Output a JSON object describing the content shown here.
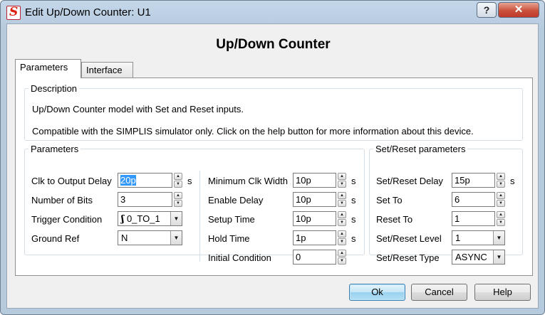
{
  "window": {
    "title": "Edit Up/Down Counter: U1",
    "help_glyph": "?",
    "close_glyph": "✕"
  },
  "dialog": {
    "heading": "Up/Down Counter"
  },
  "tabs": [
    {
      "label": "Parameters"
    },
    {
      "label": "Interface"
    }
  ],
  "description": {
    "legend": "Description",
    "line1": "Up/Down Counter model with Set and Reset inputs.",
    "line2": "Compatible with the SIMPLIS simulator only. Click on the help button for more information about this device."
  },
  "parameters": {
    "legend": "Parameters",
    "clk_to_output_delay": {
      "label": "Clk to Output Delay",
      "value": "20p",
      "unit": "s"
    },
    "number_of_bits": {
      "label": "Number of Bits",
      "value": "3"
    },
    "trigger_condition": {
      "label": "Trigger Condition",
      "value": "0_TO_1",
      "glyph": "ʃ"
    },
    "ground_ref": {
      "label": "Ground Ref",
      "value": "N"
    },
    "minimum_clk_width": {
      "label": "Minimum Clk Width",
      "value": "10p",
      "unit": "s"
    },
    "enable_delay": {
      "label": "Enable Delay",
      "value": "10p",
      "unit": "s"
    },
    "setup_time": {
      "label": "Setup Time",
      "value": "10p",
      "unit": "s"
    },
    "hold_time": {
      "label": "Hold Time",
      "value": "1p",
      "unit": "s"
    },
    "initial_condition": {
      "label": "Initial Condition",
      "value": "0"
    }
  },
  "set_reset": {
    "legend": "Set/Reset parameters",
    "delay": {
      "label": "Set/Reset Delay",
      "value": "15p",
      "unit": "s"
    },
    "set_to": {
      "label": "Set To",
      "value": "6"
    },
    "reset_to": {
      "label": "Reset To",
      "value": "1"
    },
    "level": {
      "label": "Set/Reset Level",
      "value": "1"
    },
    "type": {
      "label": "Set/Reset Type",
      "value": "ASYNC"
    }
  },
  "buttons": {
    "ok": "Ok",
    "cancel": "Cancel",
    "help": "Help"
  },
  "icons": {
    "spin_up": "▲",
    "spin_down": "▼",
    "dropdown": "▼",
    "app": "S"
  },
  "colors": {
    "selection": "#3399ff",
    "close_button": "#c9513b",
    "title_bar": "#c4d6ea"
  }
}
